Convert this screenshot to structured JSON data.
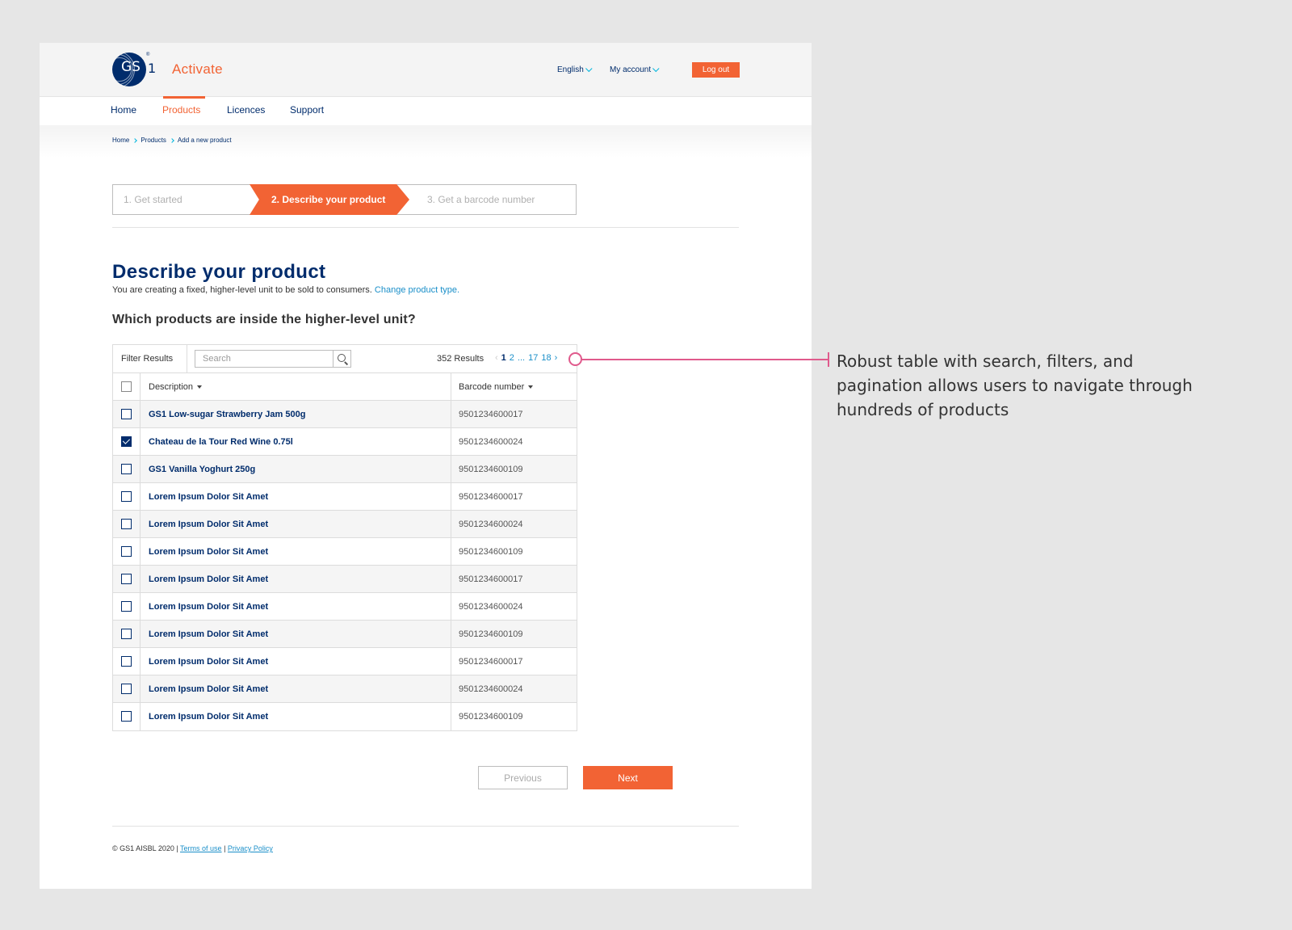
{
  "header": {
    "logo_text": "GS",
    "logo_number": "1",
    "logo_reg": "®",
    "app_title": "Activate",
    "language": "English",
    "account": "My account",
    "logout": "Log out"
  },
  "nav": {
    "items": [
      {
        "label": "Home"
      },
      {
        "label": "Products",
        "active": true
      },
      {
        "label": "Licences"
      },
      {
        "label": "Support"
      }
    ]
  },
  "breadcrumb": [
    "Home",
    "Products",
    "Add a new product"
  ],
  "steps": [
    {
      "label": "1. Get started"
    },
    {
      "label": "2. Describe your product",
      "active": true
    },
    {
      "label": "3. Get a barcode number"
    }
  ],
  "main": {
    "title": "Describe your product",
    "subtitle": "You are creating a fixed, higher-level unit to be sold to consumers.",
    "change_link": "Change product type.",
    "question": "Which products are inside the higher-level unit?"
  },
  "table": {
    "filter_label": "Filter Results",
    "search_placeholder": "Search",
    "results": "352 Results",
    "pages": [
      "1",
      "2",
      "...",
      "17",
      "18"
    ],
    "columns": {
      "description": "Description",
      "barcode": "Barcode number"
    },
    "rows": [
      {
        "description": "GS1 Low-sugar Strawberry Jam 500g",
        "barcode": "9501234600017",
        "checked": false
      },
      {
        "description": "Chateau de la Tour Red Wine 0.75l",
        "barcode": "9501234600024",
        "checked": true
      },
      {
        "description": "GS1 Vanilla Yoghurt 250g",
        "barcode": "9501234600109",
        "checked": false
      },
      {
        "description": "Lorem Ipsum Dolor Sit Amet",
        "barcode": "9501234600017",
        "checked": false
      },
      {
        "description": "Lorem Ipsum Dolor Sit Amet",
        "barcode": "9501234600024",
        "checked": false
      },
      {
        "description": "Lorem Ipsum Dolor Sit Amet",
        "barcode": "9501234600109",
        "checked": false
      },
      {
        "description": "Lorem Ipsum Dolor Sit Amet",
        "barcode": "9501234600017",
        "checked": false
      },
      {
        "description": "Lorem Ipsum Dolor Sit Amet",
        "barcode": "9501234600024",
        "checked": false
      },
      {
        "description": "Lorem Ipsum Dolor Sit Amet",
        "barcode": "9501234600109",
        "checked": false
      },
      {
        "description": "Lorem Ipsum Dolor Sit Amet",
        "barcode": "9501234600017",
        "checked": false
      },
      {
        "description": "Lorem Ipsum Dolor Sit Amet",
        "barcode": "9501234600024",
        "checked": false
      },
      {
        "description": "Lorem Ipsum Dolor Sit Amet",
        "barcode": "9501234600109",
        "checked": false
      }
    ]
  },
  "actions": {
    "previous": "Previous",
    "next": "Next"
  },
  "footer": {
    "copyright": "© GS1 AISBL 2020 | ",
    "terms": "Terms of use",
    "separator": " | ",
    "privacy": "Privacy Policy"
  },
  "annotation": {
    "text": "Robust table with search, filters, and pagination allows users to navigate through hundreds of products"
  },
  "colors": {
    "brand_orange": "#f26334",
    "brand_navy": "#002c6c",
    "link_blue": "#1a8fc9",
    "annotation_pink": "#e05a8c"
  },
  "icons": [
    "search-icon",
    "chevron-down-icon",
    "chevron-right-icon",
    "chevron-left-icon",
    "sort-caret-icon",
    "checkmark-icon"
  ]
}
